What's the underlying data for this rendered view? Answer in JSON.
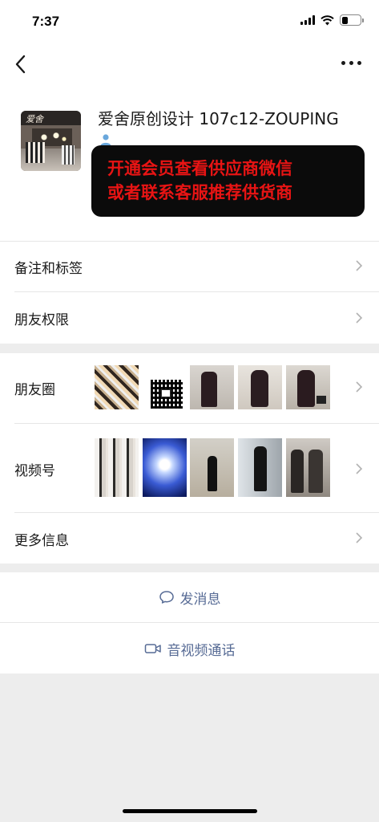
{
  "status_bar": {
    "time": "7:37"
  },
  "contact": {
    "name": "爱舍原创设计 107c12-ZOUPING",
    "avatar_sign": "爱舍"
  },
  "promo": {
    "line1": "开通会员查看供应商微信",
    "line2": "或者联系客服推荐供货商"
  },
  "rows": {
    "remarks": "备注和标签",
    "permissions": "朋友权限",
    "moments": "朋友圈",
    "channels": "视频号",
    "more_info": "更多信息"
  },
  "actions": {
    "message": "发消息",
    "call": "音视频通话"
  },
  "colors": {
    "link": "#576b95",
    "promo_text": "#e81414",
    "promo_bg": "#0b0b0b"
  }
}
